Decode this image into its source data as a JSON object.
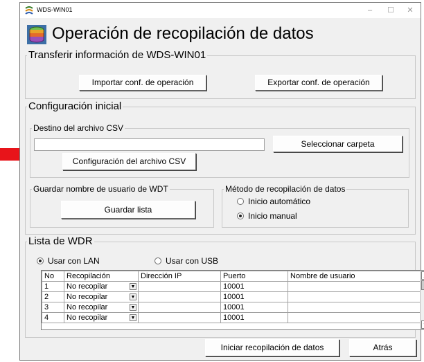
{
  "window": {
    "title": "WDS-WIN01",
    "minimize": "–",
    "maximize": "☐",
    "close": "✕"
  },
  "heading": "Operación de recopilación de datos",
  "transfer": {
    "title": "Transferir información de WDS-WIN01",
    "import_label": "Importar conf. de operación",
    "export_label": "Exportar conf. de operación"
  },
  "initial": {
    "title": "Configuración inicial",
    "csv_dest": {
      "title": "Destino del archivo CSV",
      "path_value": "",
      "select_folder_label": "Seleccionar carpeta",
      "csv_config_label": "Configuración del archivo CSV"
    },
    "save_user": {
      "title": "Guardar nombre de usuario de WDT",
      "save_list_label": "Guardar lista"
    },
    "method": {
      "title": "Método de recopilación de datos",
      "auto_label": "Inicio automático",
      "manual_label": "Inicio manual",
      "selected": "manual"
    }
  },
  "wdr": {
    "title": "Lista de WDR",
    "lan_label": "Usar con LAN",
    "usb_label": "Usar con USB",
    "selected": "lan",
    "columns": [
      "No",
      "Recopilación",
      "Dirección IP",
      "Puerto",
      "Nombre de usuario"
    ],
    "rows": [
      {
        "no": "1",
        "collection": "No recopilar",
        "ip": "",
        "port": "10001",
        "user": ""
      },
      {
        "no": "2",
        "collection": "No recopilar",
        "ip": "",
        "port": "10001",
        "user": ""
      },
      {
        "no": "3",
        "collection": "No recopilar",
        "ip": "",
        "port": "10001",
        "user": ""
      },
      {
        "no": "4",
        "collection": "No recopilar",
        "ip": "",
        "port": "10001",
        "user": ""
      }
    ]
  },
  "footer": {
    "start_label": "Iniciar recopilación de datos",
    "back_label": "Atrás"
  },
  "colors": {
    "annotation_arrow": "#e8141a",
    "window_bg": "#f0f0f0"
  },
  "icons": {
    "app": "database-icon",
    "annotation": "red-arrow-icon"
  }
}
